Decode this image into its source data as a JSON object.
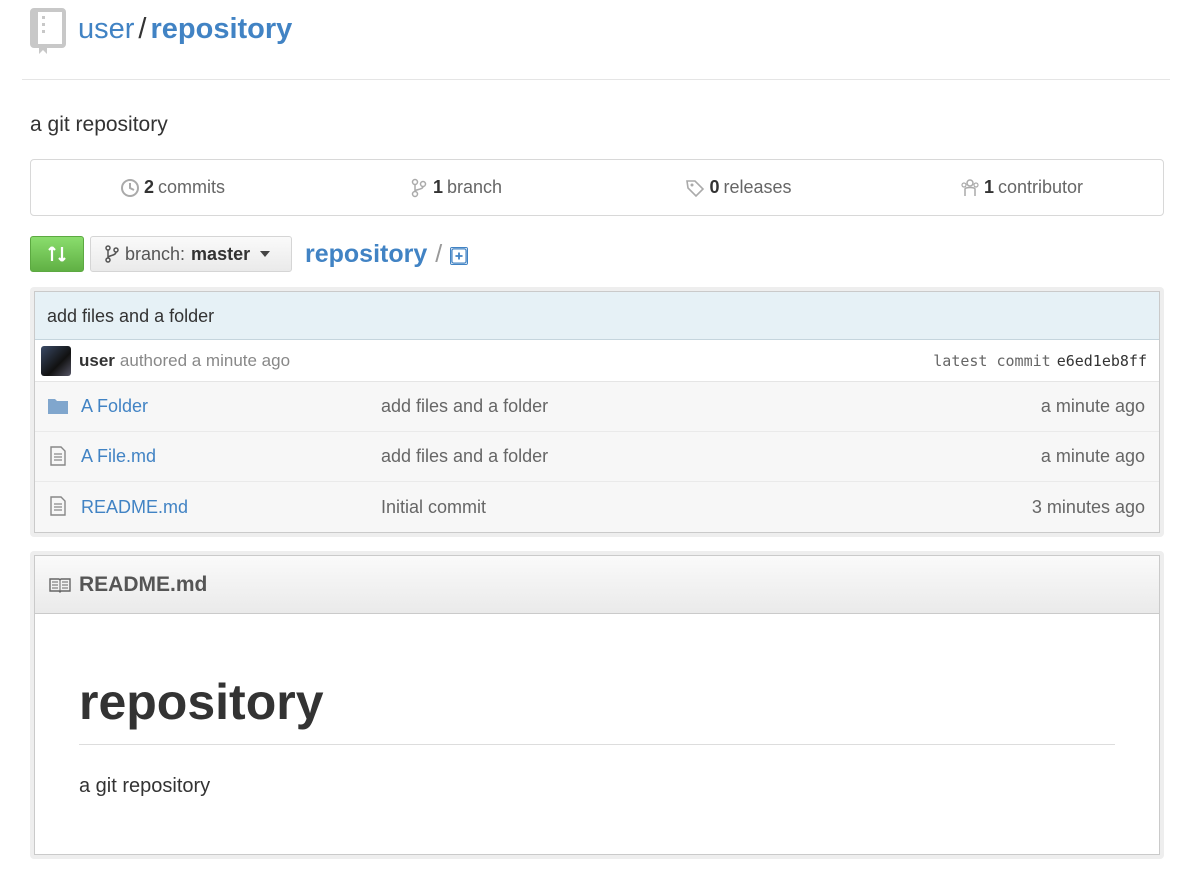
{
  "header": {
    "owner": "user",
    "separator": "/",
    "repo": "repository"
  },
  "description": "a git repository",
  "stats": [
    {
      "icon": "history-icon",
      "count": "2",
      "label": "commits"
    },
    {
      "icon": "branch-icon",
      "count": "1",
      "label": "branch"
    },
    {
      "icon": "tag-icon",
      "count": "0",
      "label": "releases"
    },
    {
      "icon": "people-icon",
      "count": "1",
      "label": "contributor"
    }
  ],
  "toolbar": {
    "branch_label": "branch:",
    "branch_value": "master",
    "breadcrumb_repo": "repository",
    "breadcrumb_sep": "/"
  },
  "latest_commit": {
    "message": "add files and a folder",
    "author": "user",
    "authored": "authored a minute ago",
    "latest_label": "latest commit",
    "sha": "e6ed1eb8ff"
  },
  "files": [
    {
      "type": "folder",
      "name": "A Folder",
      "message": "add files and a folder",
      "age": "a minute ago"
    },
    {
      "type": "file",
      "name": "A File.md",
      "message": "add files and a folder",
      "age": "a minute ago"
    },
    {
      "type": "file",
      "name": "README.md",
      "message": "Initial commit",
      "age": "3 minutes ago"
    }
  ],
  "readme": {
    "filename": "README.md",
    "heading": "repository",
    "body": "a git repository"
  },
  "colors": {
    "link": "#4183c4",
    "compare_green": "#60b044",
    "commit_bg": "#e6f1f6"
  }
}
